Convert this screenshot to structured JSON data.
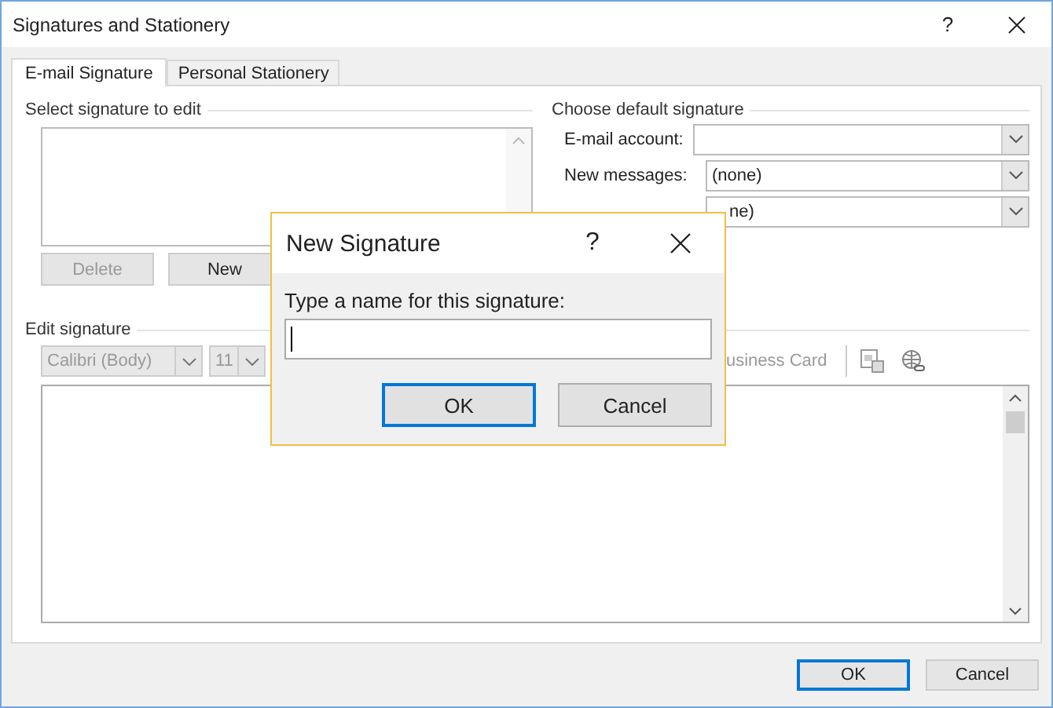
{
  "window": {
    "title": "Signatures and Stationery",
    "help": "?"
  },
  "tabs": [
    {
      "label": "E-mail Signature",
      "selected": true
    },
    {
      "label": "Personal Stationery",
      "selected": false
    }
  ],
  "select_section": {
    "title": "Select signature to edit",
    "buttons": [
      {
        "label": "Delete",
        "disabled": true
      },
      {
        "label": "New",
        "disabled": false
      }
    ]
  },
  "default_section": {
    "title": "Choose default signature",
    "fields": [
      {
        "label": "E-mail account:"
      },
      {
        "label": "New messages:",
        "value": "(none)"
      },
      {
        "value": "ne)"
      }
    ]
  },
  "edit_section": {
    "title": "Edit signature",
    "font": "Calibri (Body)",
    "size": "11",
    "toolbar_text": "usiness Card"
  },
  "buttons": [
    {
      "label": "OK",
      "default": true
    },
    {
      "label": "Cancel",
      "default": false
    }
  ],
  "dialog": {
    "title": "New Signature",
    "help": "?",
    "prompt": "Type a name for this signature:",
    "buttons": [
      {
        "label": "OK",
        "default": true
      },
      {
        "label": "Cancel",
        "default": false
      }
    ]
  }
}
